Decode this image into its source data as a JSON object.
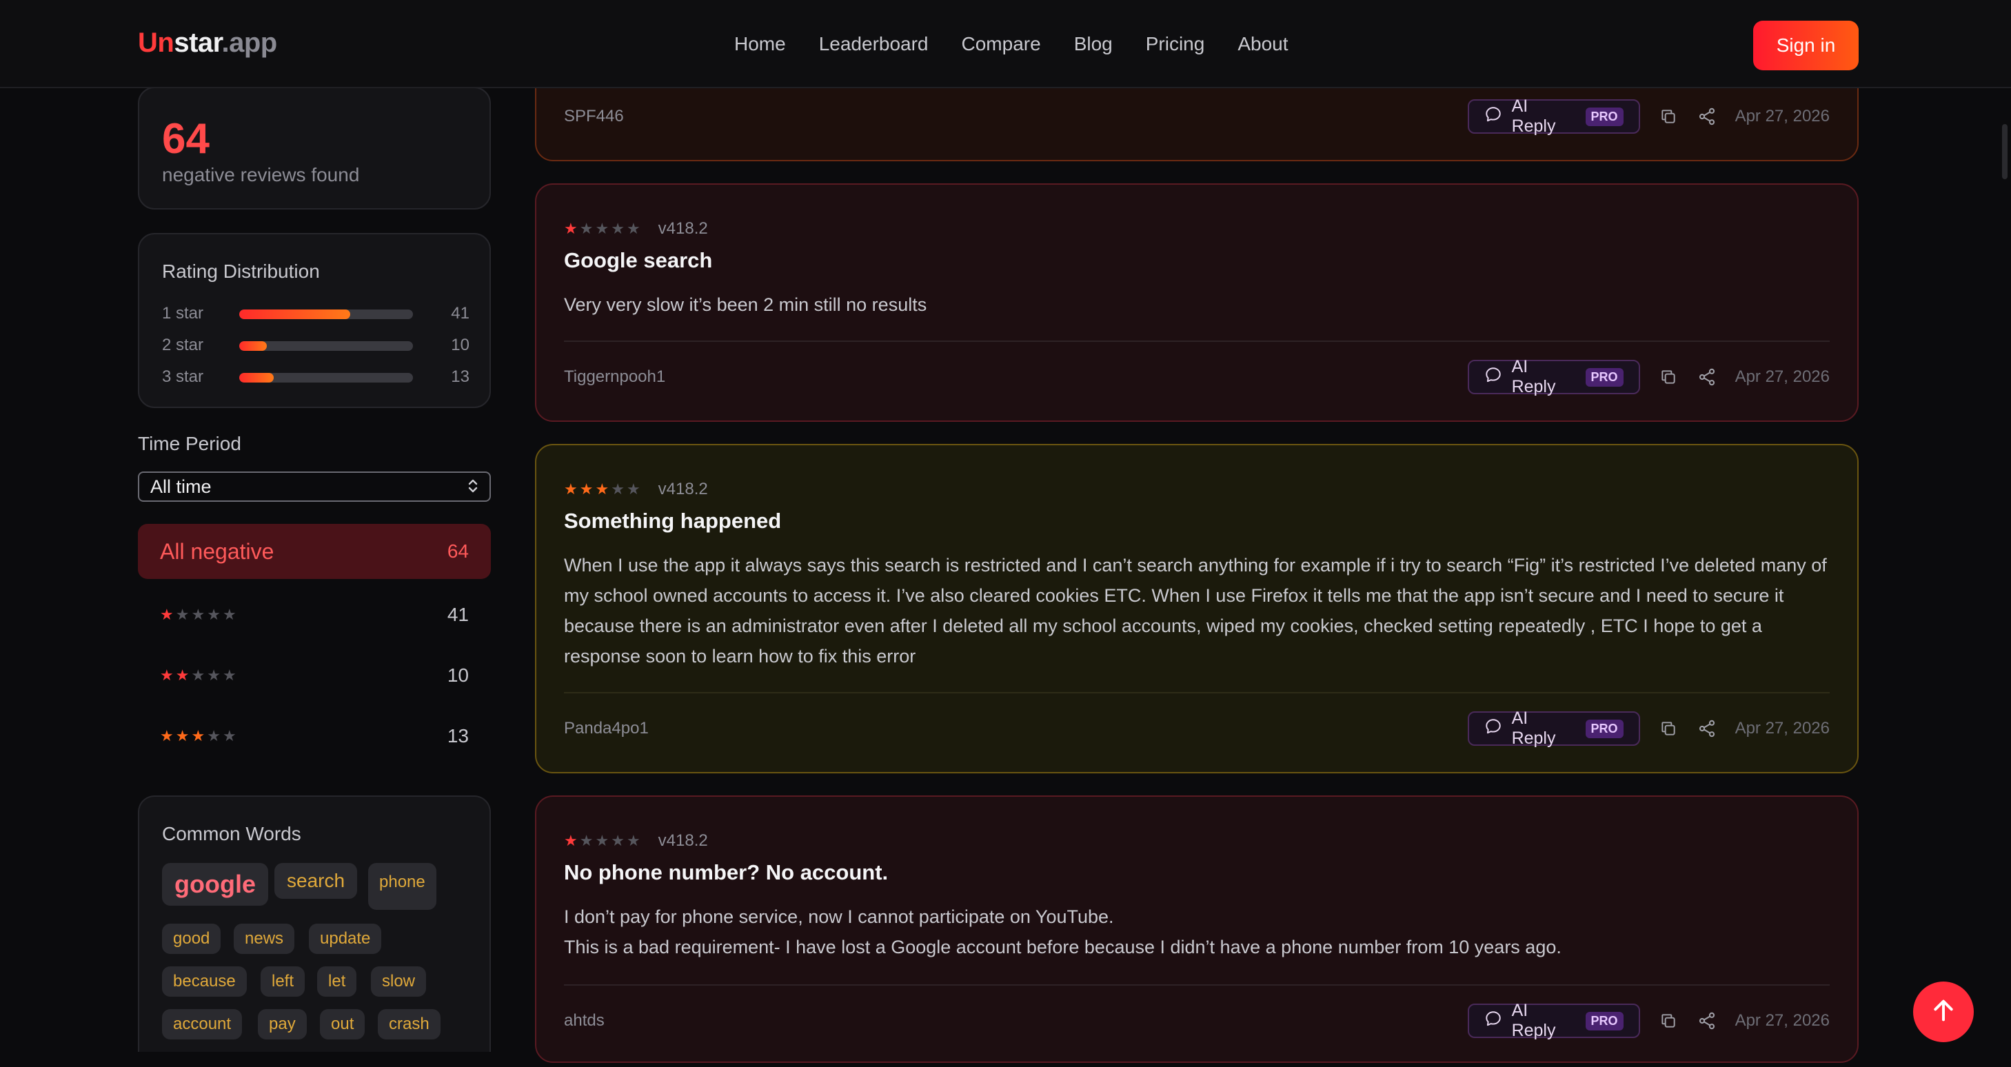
{
  "header": {
    "logo": {
      "part1": "Un",
      "part2": "star",
      "part3": ".app"
    },
    "nav": [
      "Home",
      "Leaderboard",
      "Compare",
      "Blog",
      "Pricing",
      "About"
    ],
    "signin_label": "Sign in"
  },
  "sidebar": {
    "count": "64",
    "count_label": "negative reviews found",
    "distribution": {
      "title": "Rating Distribution",
      "rows": [
        {
          "label": "1 star",
          "count": "41",
          "fraction": 0.64
        },
        {
          "label": "2 star",
          "count": "10",
          "fraction": 0.16
        },
        {
          "label": "3 star",
          "count": "13",
          "fraction": 0.2
        }
      ]
    },
    "time_period": {
      "title": "Time Period",
      "selected": "All time"
    },
    "filters": [
      {
        "label": "All negative",
        "count": "64",
        "stars": 0
      },
      {
        "label": "",
        "count": "41",
        "stars": 1
      },
      {
        "label": "",
        "count": "10",
        "stars": 2
      },
      {
        "label": "",
        "count": "13",
        "stars": 3
      }
    ],
    "common_words": {
      "title": "Common Words",
      "words": [
        "google",
        "search",
        "phone",
        "good",
        "news",
        "update",
        "because",
        "left",
        "let",
        "slow",
        "account",
        "pay",
        "out",
        "crash"
      ]
    }
  },
  "reviews": [
    {
      "author": "SPF446",
      "date": "Apr 27, 2026"
    },
    {
      "stars": 1,
      "version": "v418.2",
      "title": "Google search",
      "body": [
        "Very very slow it’s been 2 min still no results"
      ],
      "author": "Tiggernpooh1",
      "date": "Apr 27, 2026"
    },
    {
      "stars": 3,
      "version": "v418.2",
      "title": "Something happened",
      "body": [
        "When I use the app it always says this search is restricted and I can’t search anything for example if i try to search “Fig” it’s restricted I’ve deleted many of my school owned accounts to access it. I’ve also cleared cookies ETC. When I use Firefox it tells me that the app isn’t secure and I need to secure it because there is an administrator even after I deleted all my school accounts, wiped my cookies, checked setting repeatedly , ETC I hope to get a response soon to learn how to fix this error"
      ],
      "author": "Panda4po1",
      "date": "Apr 27, 2026"
    },
    {
      "stars": 1,
      "version": "v418.2",
      "title": "No phone number? No account.",
      "body": [
        "I don’t pay for phone service, now I cannot participate on YouTube.",
        "This is a bad requirement- I have lost a Google account before because I didn’t have a phone number from 10 years ago."
      ],
      "author": "ahtds",
      "date": "Apr 27, 2026"
    }
  ],
  "actions": {
    "ai_reply": "AI Reply",
    "pro_badge": "PRO"
  },
  "colors": {
    "accent": "#ff3b3b",
    "accent_orange": "#ff6a1a",
    "background": "#0b0b0d"
  }
}
